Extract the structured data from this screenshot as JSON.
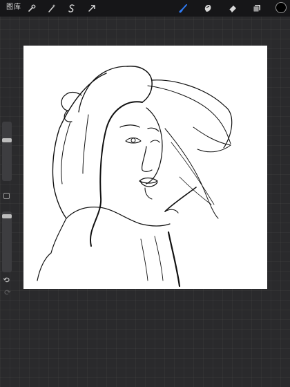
{
  "toolbar": {
    "gallery_label": "图库",
    "left_tools": [
      "wrench-icon",
      "magic-wand-icon",
      "selection-s-icon",
      "transform-arrow-icon"
    ],
    "right_tools": [
      "brush-icon",
      "smudge-icon",
      "eraser-icon",
      "layers-icon"
    ],
    "active_tool": "brush-icon",
    "accent_color": "#2f7cf6",
    "current_color": "#000000"
  },
  "sidebar": {
    "brush_size_level": 0.7,
    "opacity_level": 0.95
  },
  "canvas": {
    "background": "#ffffff",
    "content": "line-art sketch"
  }
}
